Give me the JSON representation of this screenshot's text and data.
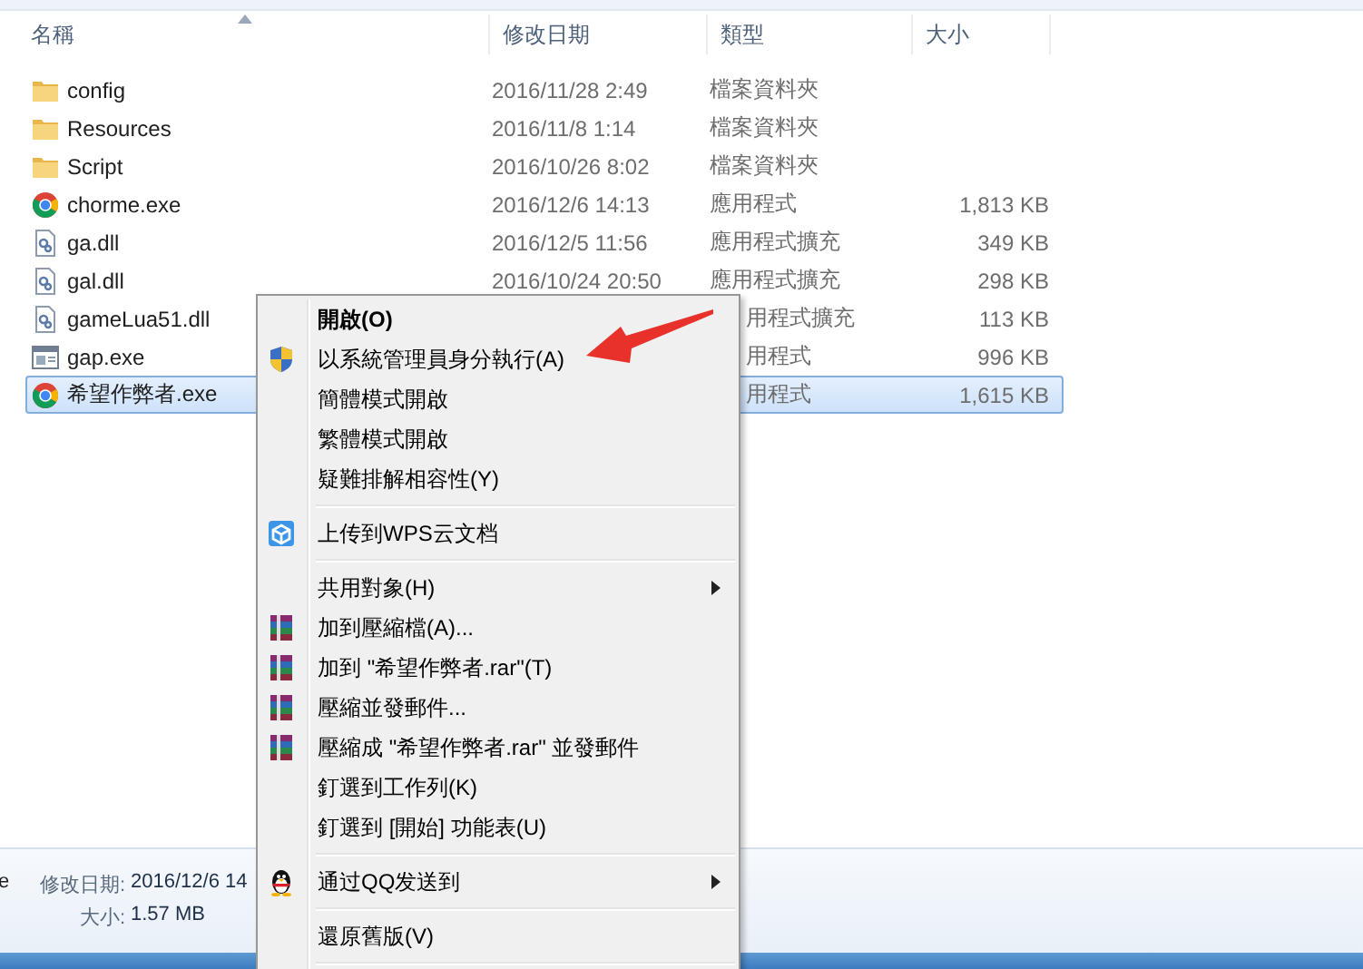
{
  "columns": [
    {
      "label": "名稱",
      "sorted": true
    },
    {
      "label": "修改日期",
      "sorted": false
    },
    {
      "label": "類型",
      "sorted": false
    },
    {
      "label": "大小",
      "sorted": false
    }
  ],
  "rows": [
    {
      "kind": "folder",
      "name": "config",
      "modified": "2016/11/28 2:49",
      "type": "檔案資料夾",
      "selected": false
    },
    {
      "kind": "folder",
      "name": "Resources",
      "modified": "2016/11/8 1:14",
      "type": "檔案資料夾",
      "selected": false
    },
    {
      "kind": "folder",
      "name": "Script",
      "modified": "2016/10/26 8:02",
      "type": "檔案資料夾",
      "selected": false
    },
    {
      "kind": "browser",
      "name": "chorme.exe",
      "modified": "2016/12/6 14:13",
      "type": "應用程式",
      "size": "1,813 KB",
      "selected": false
    },
    {
      "kind": "library",
      "name": "ga.dll",
      "modified": "2016/12/5 11:56",
      "type": "應用程式擴充",
      "size": "349 KB",
      "selected": false
    },
    {
      "kind": "library",
      "name": "gal.dll",
      "modified": "2016/10/24 20:50",
      "type": "應用程式擴充",
      "size": "298 KB",
      "selected": false
    },
    {
      "kind": "library",
      "name": "gameLua51.dll",
      "type": "用程式擴充",
      "size": "113 KB",
      "selected": false
    },
    {
      "kind": "program",
      "name": "gap.exe",
      "type": "用程式",
      "size": "996 KB",
      "selected": false
    },
    {
      "kind": "browser",
      "name": "希望作弊者.exe",
      "type": "用程式",
      "size": "1,615 KB",
      "selected": true
    }
  ],
  "details": {
    "name": "e",
    "fields": [
      {
        "label": "修改日期:",
        "value": "2016/12/6 14"
      },
      {
        "label": "大小:",
        "value": "1.57 MB"
      }
    ]
  },
  "context_menu": [
    {
      "kind": "plain",
      "label": "開啟(O)",
      "default": true,
      "submenu": false
    },
    {
      "kind": "shield",
      "label": "以系統管理員身分執行(A)",
      "default": false,
      "submenu": false
    },
    {
      "kind": "plain",
      "label": "簡體模式開啟",
      "default": false,
      "submenu": false
    },
    {
      "kind": "plain",
      "label": "繁體模式開啟",
      "default": false,
      "submenu": false
    },
    {
      "kind": "plain",
      "label": "疑難排解相容性(Y)",
      "default": false,
      "submenu": false
    },
    {
      "kind": "separator"
    },
    {
      "kind": "cloud",
      "label": "上传到WPS云文档",
      "default": false,
      "submenu": false
    },
    {
      "kind": "separator"
    },
    {
      "kind": "plain",
      "label": "共用對象(H)",
      "default": false,
      "submenu": true
    },
    {
      "kind": "archive",
      "label": "加到壓縮檔(A)...",
      "default": false,
      "submenu": false
    },
    {
      "kind": "archive",
      "label": "加到 \"希望作弊者.rar\"(T)",
      "default": false,
      "submenu": false
    },
    {
      "kind": "archive",
      "label": "壓縮並發郵件...",
      "default": false,
      "submenu": false
    },
    {
      "kind": "archive",
      "label": "壓縮成 \"希望作弊者.rar\" 並發郵件",
      "default": false,
      "submenu": false
    },
    {
      "kind": "plain",
      "label": "釘選到工作列(K)",
      "default": false,
      "submenu": false
    },
    {
      "kind": "plain",
      "label": "釘選到 [開始] 功能表(U)",
      "default": false,
      "submenu": false
    },
    {
      "kind": "separator"
    },
    {
      "kind": "penguin",
      "label": "通过QQ发送到",
      "default": false,
      "submenu": true
    },
    {
      "kind": "separator"
    },
    {
      "kind": "plain",
      "label": "還原舊版(V)",
      "default": false,
      "submenu": false
    },
    {
      "kind": "separator"
    }
  ]
}
